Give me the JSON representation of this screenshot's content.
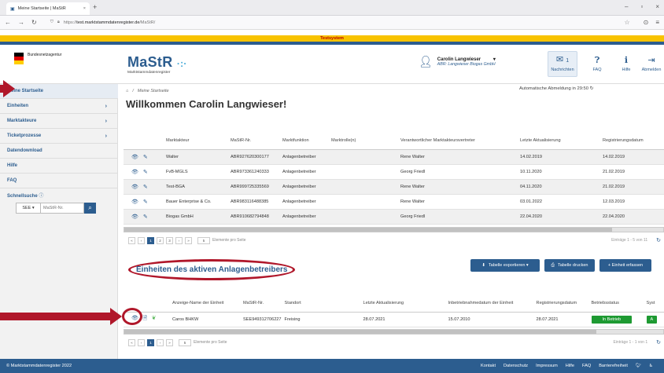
{
  "browser": {
    "tab_title": "Meine Startseite | MaStR",
    "tab_close": "×",
    "new_tab": "+",
    "url_host": "test.marktstammdatenregister.de",
    "url_path": "/MaStR/",
    "win_controls": [
      "–",
      "▫",
      "×"
    ]
  },
  "testbar": "Testsystem",
  "header": {
    "bund_text": "Bundesnetzagentur",
    "logo": "MaStR",
    "logo_dots": "·:·",
    "logo_sub": "Marktstammdatenregister",
    "user_name": "Carolin Langwieser",
    "user_org": "ABR: Langwieser Biogas GmbH",
    "msg_count": "1",
    "msg_label": "Nachrichten",
    "faq_label": "FAQ",
    "hilfe_label": "Hilfe",
    "logout_label": "Abmelden"
  },
  "sidebar": {
    "items": [
      {
        "label": "Meine Startseite",
        "chev": ""
      },
      {
        "label": "Einheiten",
        "chev": "›"
      },
      {
        "label": "Marktakteure",
        "chev": "›"
      },
      {
        "label": "Ticketprozesse",
        "chev": "›"
      },
      {
        "label": "Datendownload",
        "chev": ""
      },
      {
        "label": "Hilfe",
        "chev": ""
      },
      {
        "label": "FAQ",
        "chev": ""
      }
    ],
    "quick_label": "Schnellsuche",
    "quick_select": "SEE ▾",
    "quick_placeholder": "MaStR-Nr."
  },
  "main": {
    "breadcrumb": "Meine Startseite",
    "autologout": "Automatische Abmeldung in 29:50",
    "welcome": "Willkommen Carolin Langwieser!",
    "table1": {
      "columns": [
        "",
        "Marktakteur",
        "MaStR-Nr.",
        "Marktfunktion",
        "Marktrolle(n)",
        "Verantwortlicher Marktakteursvertreter",
        "Letzte Aktualisierung",
        "Registrierungsdatum"
      ],
      "rows": [
        [
          "Walter",
          "ABR927620300177",
          "Anlagenbetreiber",
          "",
          "Rene Walter",
          "14.02.2019",
          "14.02.2019"
        ],
        [
          "FvB-MGLS",
          "ABR973361240333",
          "Anlagenbetreiber",
          "",
          "Georg Friedl",
          "10.11.2020",
          "21.02.2019"
        ],
        [
          "Test-BGA",
          "ABR999725335569",
          "Anlagenbetreiber",
          "",
          "Rene Walter",
          "04.11.2020",
          "21.02.2019"
        ],
        [
          "Bauer Enterprise & Co.",
          "ABR983116488385",
          "Anlagenbetreiber",
          "",
          "Rene Walter",
          "03.01.2022",
          "12.03.2019"
        ],
        [
          "Biogas GmbH",
          "ABR910682794848",
          "Anlagenbetreiber",
          "",
          "Georg Friedl",
          "22.04.2020",
          "22.04.2020"
        ]
      ],
      "pages": [
        "«",
        "‹",
        "1",
        "2",
        "3",
        "›",
        "»"
      ],
      "page_size": "5",
      "per_page_label": "Elemente pro Seite",
      "page_info": "Einträge 1 - 5 von 11"
    },
    "section2_title": "Einheiten des aktiven Anlagenbetreibers",
    "btn_export": "Tabelle exportieren ▾",
    "btn_print": "Tabelle drucken",
    "btn_add": "+ Einheit erfassen",
    "table2": {
      "columns": [
        "",
        "Anzeige-Name der Einheit",
        "MaStR-Nr.",
        "Standort",
        "Letzte Aktualisierung",
        "Inbetriebnahmedatum der Einheit",
        "Registrierungsdatum",
        "Betriebsstatus",
        "Syst"
      ],
      "row": [
        "Caros BHKW",
        "SEE949312706227",
        "Freising",
        "28.07.2021",
        "15.07.2010",
        "28.07.2021",
        "In Betrieb",
        "A"
      ],
      "pages": [
        "«",
        "‹",
        "1",
        "›",
        "»"
      ],
      "page_size": "5",
      "per_page_label": "Elemente pro Seite",
      "page_info": "Einträge 1 - 1 von 1"
    }
  },
  "footer": {
    "copyright": "© Marktstammdatenregister 2022",
    "links": [
      "Kontakt",
      "Datenschutz",
      "Impressum",
      "Hilfe",
      "FAQ",
      "Barrierefreiheit"
    ]
  }
}
